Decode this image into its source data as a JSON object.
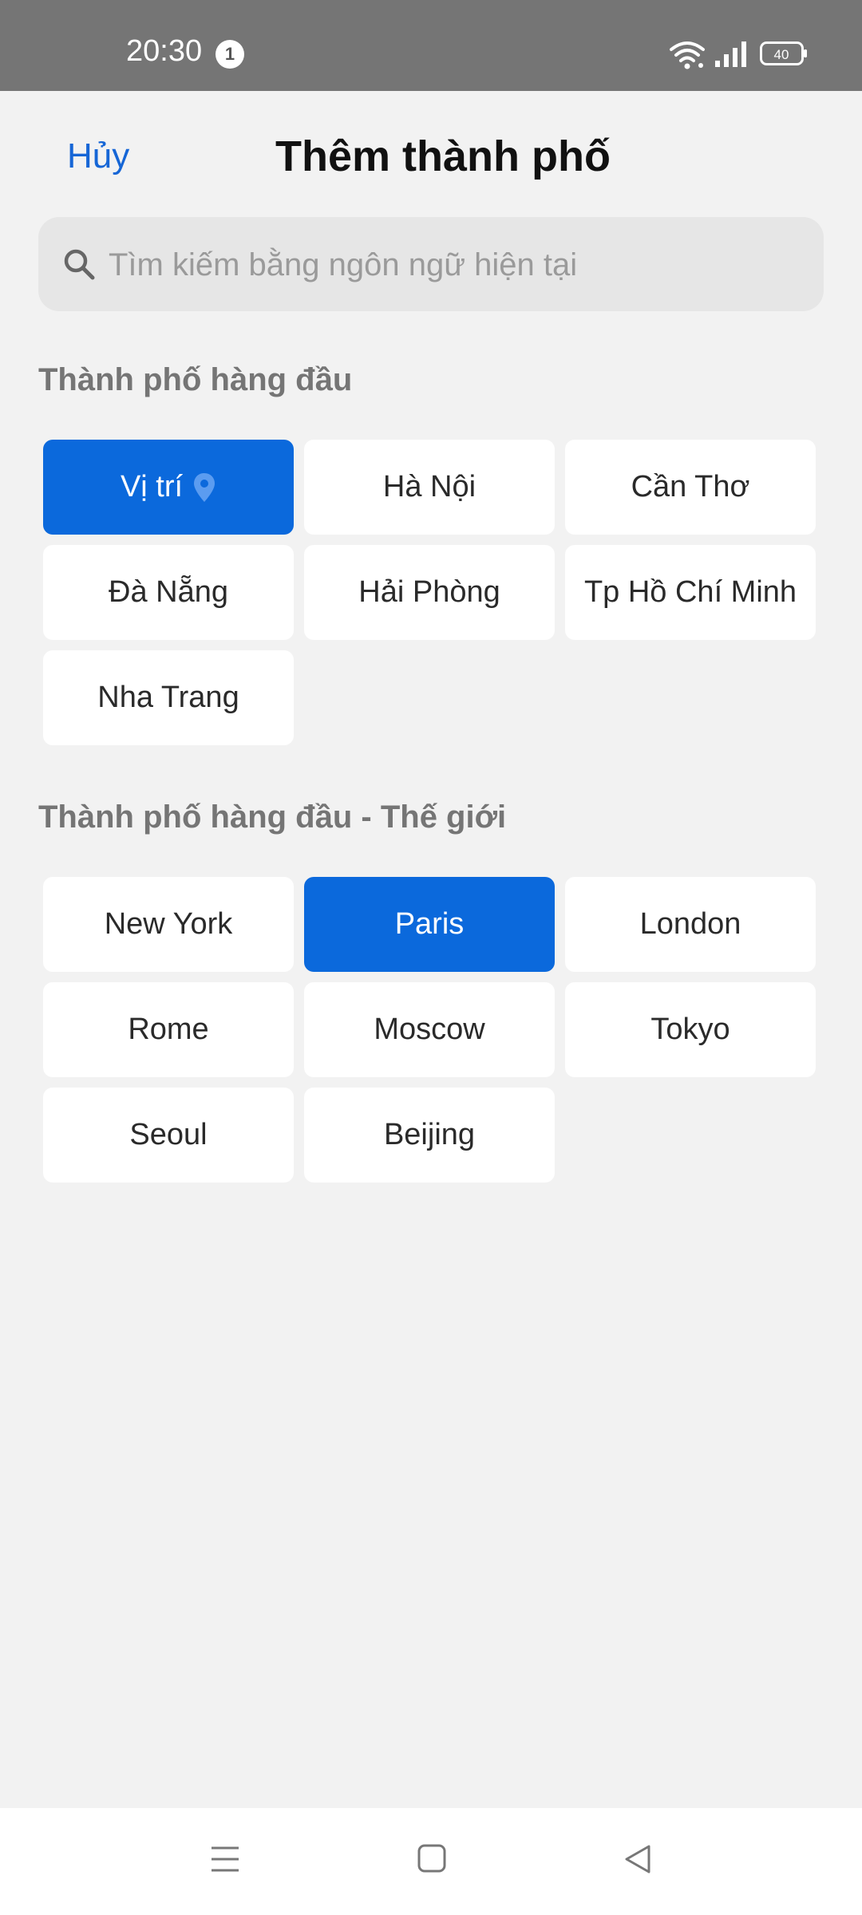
{
  "status_bar": {
    "time": "20:30",
    "notification_count": "1",
    "battery": "40",
    "icons": [
      "wifi-icon",
      "signal-icon",
      "battery-icon"
    ]
  },
  "header": {
    "cancel_label": "Hủy",
    "title": "Thêm thành phố"
  },
  "search": {
    "placeholder": "Tìm kiếm bằng ngôn ngữ hiện tại",
    "value": ""
  },
  "top_cities": {
    "heading": "Thành phố hàng đầu",
    "items": [
      {
        "label": "Vị trí",
        "selected": true,
        "icon": "location-pin-icon"
      },
      {
        "label": "Hà Nội",
        "selected": false
      },
      {
        "label": "Cần Thơ",
        "selected": false
      },
      {
        "label": "Đà Nẵng",
        "selected": false
      },
      {
        "label": "Hải Phòng",
        "selected": false
      },
      {
        "label": "Tp Hồ Chí Minh",
        "selected": false
      },
      {
        "label": "Nha Trang",
        "selected": false
      }
    ]
  },
  "world_cities": {
    "heading": "Thành phố hàng đầu - Thế giới",
    "items": [
      {
        "label": "New York",
        "selected": false
      },
      {
        "label": "Paris",
        "selected": true
      },
      {
        "label": "London",
        "selected": false
      },
      {
        "label": "Rome",
        "selected": false
      },
      {
        "label": "Moscow",
        "selected": false
      },
      {
        "label": "Tokyo",
        "selected": false
      },
      {
        "label": "Seoul",
        "selected": false
      },
      {
        "label": "Beijing",
        "selected": false
      }
    ]
  },
  "colors": {
    "accent": "#0b69dc",
    "link": "#1666d6",
    "background": "#f2f2f2",
    "status_bar": "#757575"
  },
  "nav_bar": {
    "icons": [
      "menu-icon",
      "home-icon",
      "back-icon"
    ]
  }
}
